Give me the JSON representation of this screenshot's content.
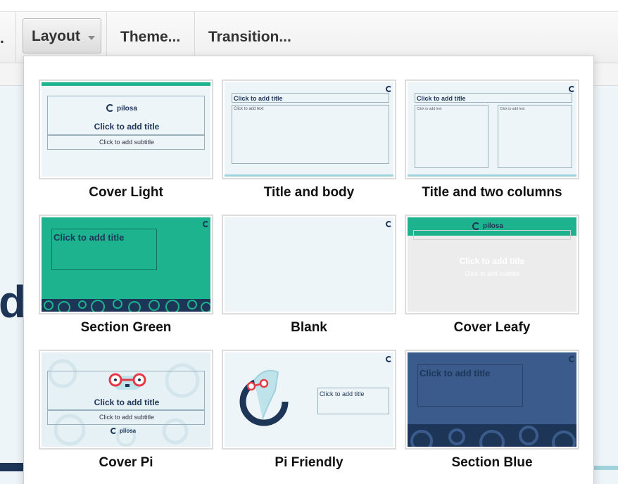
{
  "toolbar": {
    "partial_left": ".",
    "layout_label": "Layout",
    "theme_label": "Theme...",
    "transition_label": "Transition..."
  },
  "background": {
    "partial_letter": "d"
  },
  "colors": {
    "green": "#1db38f",
    "navy": "#1d3557",
    "blue": "#3a5b8c",
    "light": "#eef5f9",
    "teal": "#9fd2dc"
  },
  "layouts": [
    {
      "name": "Cover Light",
      "logo_text": "pilosa",
      "title": "Click to add title",
      "subtitle": "Click to add subtitle"
    },
    {
      "name": "Title and body",
      "title": "Click to add title",
      "body": "Click to add text"
    },
    {
      "name": "Title and two columns",
      "title": "Click to add title",
      "col1": "Click to add text",
      "col2": "Click to add text"
    },
    {
      "name": "Section Green",
      "title": "Click to add title"
    },
    {
      "name": "Blank"
    },
    {
      "name": "Cover Leafy",
      "logo_text": "pilosa",
      "title": "Click to add title",
      "subtitle": "Click to add subtitle"
    },
    {
      "name": "Cover Pi",
      "logo_text": "pilosa",
      "title": "Click to add title",
      "subtitle": "Click to add subtitle"
    },
    {
      "name": "Pi Friendly",
      "title": "Click to add title"
    },
    {
      "name": "Section Blue",
      "title": "Click to add title"
    }
  ]
}
